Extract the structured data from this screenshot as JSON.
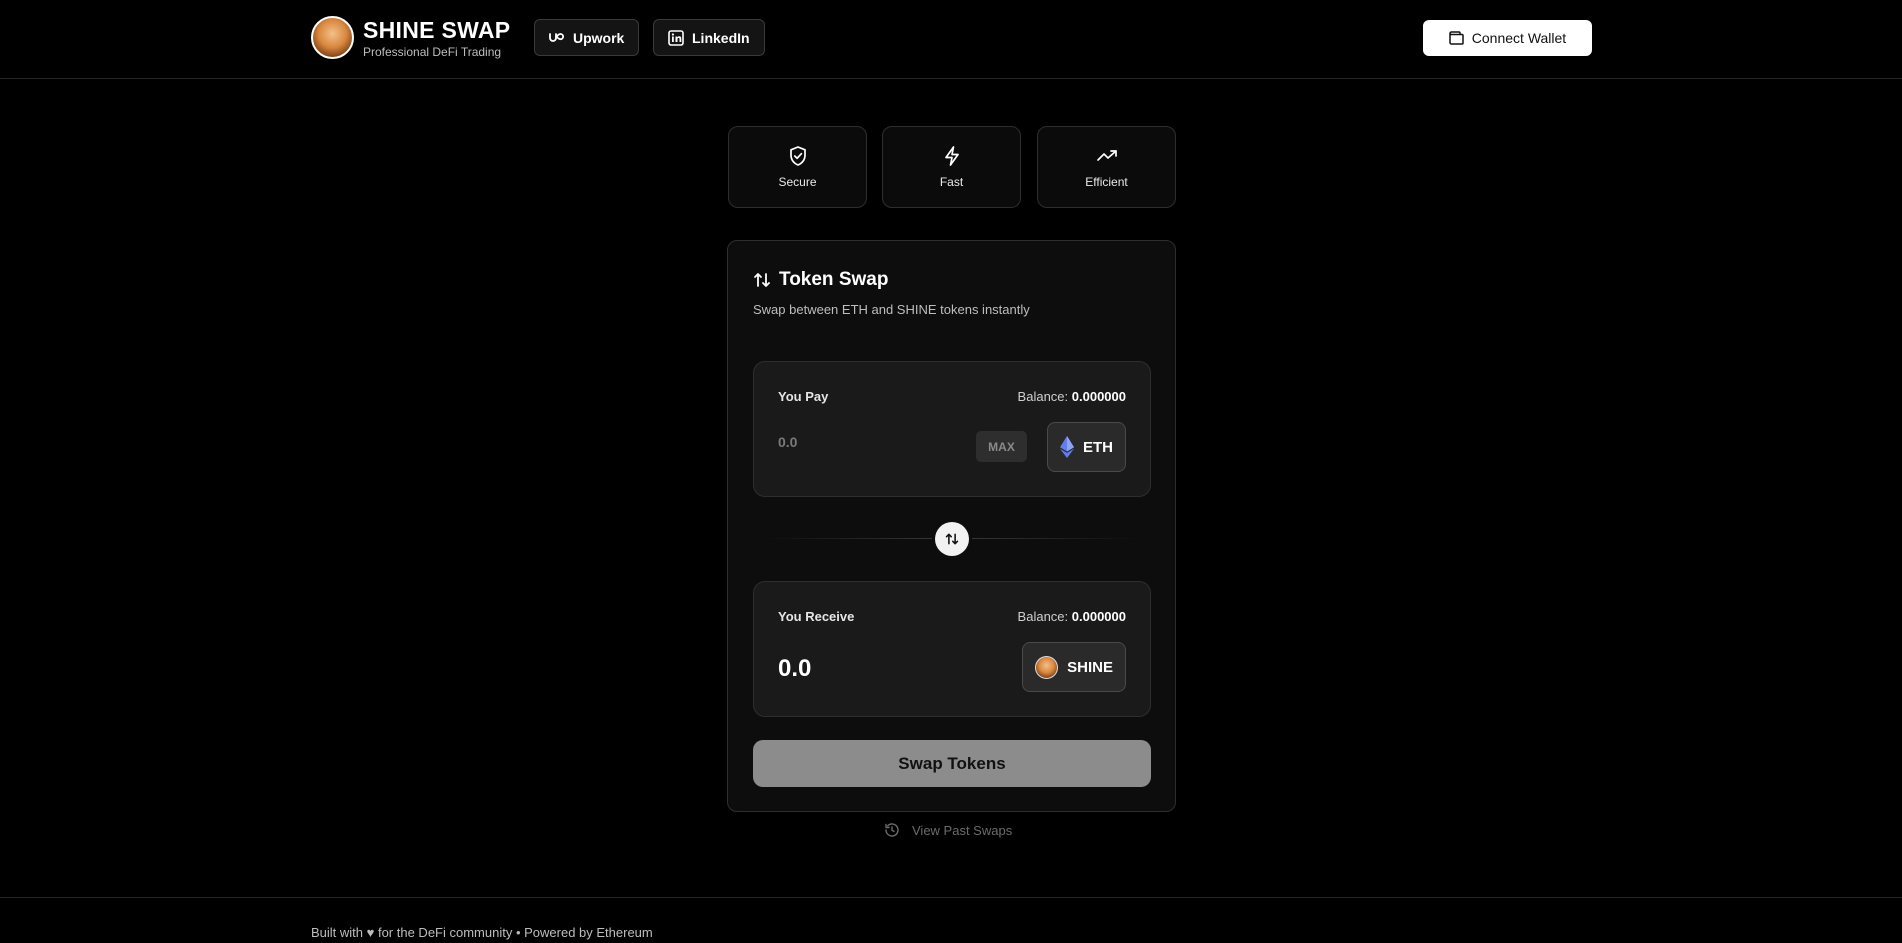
{
  "header": {
    "brand_title": "SHINE SWAP",
    "brand_subtitle": "Professional DeFi Trading",
    "links": [
      {
        "label": "Upwork",
        "icon": "upwork-icon"
      },
      {
        "label": "LinkedIn",
        "icon": "linkedin-icon"
      }
    ],
    "connect_label": "Connect Wallet",
    "connect_icon": "wallet-icon"
  },
  "features": [
    {
      "label": "Secure",
      "icon": "shield-check-icon"
    },
    {
      "label": "Fast",
      "icon": "lightning-icon"
    },
    {
      "label": "Efficient",
      "icon": "trending-up-icon"
    }
  ],
  "swap": {
    "title": "Token Swap",
    "subtitle": "Swap between ETH and SHINE tokens instantly",
    "pay": {
      "label": "You Pay",
      "balance_label": "Balance:",
      "balance_value": "0.000000",
      "placeholder": "0.0",
      "max_label": "MAX",
      "token": "ETH"
    },
    "receive": {
      "label": "You Receive",
      "balance_label": "Balance:",
      "balance_value": "0.000000",
      "amount": "0.0",
      "token": "SHINE"
    },
    "button_label": "Swap Tokens"
  },
  "history_label": "View Past Swaps",
  "footer": {
    "text": "Built with ♥ for the DeFi community • Powered by Ethereum"
  },
  "colors": {
    "background": "#000000",
    "card": "#0d0d0d",
    "panel": "#1a1a1a",
    "swap_button": "#8c8c8c",
    "eth": "#627eea"
  }
}
